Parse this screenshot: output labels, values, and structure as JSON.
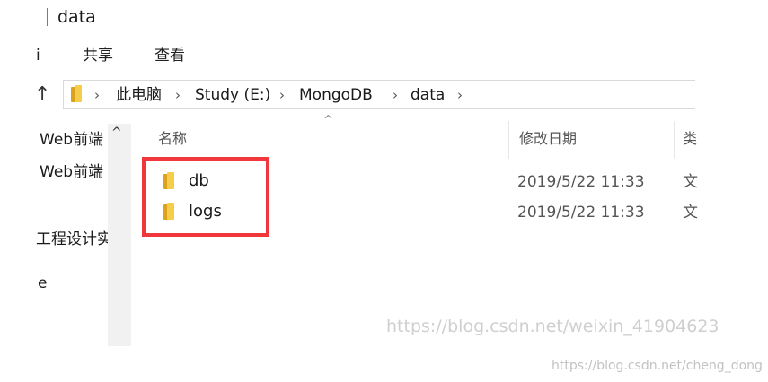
{
  "window": {
    "title": "data"
  },
  "ribbon": {
    "cut_fragment": "i",
    "tabs": [
      "共享",
      "查看"
    ]
  },
  "address": {
    "crumbs": [
      "此电脑",
      "Study (E:)",
      "MongoDB",
      "data"
    ]
  },
  "nav_pane": {
    "items": [
      "Web前端",
      "Web前端",
      "工程设计实",
      "e"
    ]
  },
  "columns": {
    "name": "名称",
    "date_modified": "修改日期",
    "type": "类"
  },
  "files": [
    {
      "name": "db",
      "date": "2019/5/22 11:33",
      "type": "文"
    },
    {
      "name": "logs",
      "date": "2019/5/22 11:33",
      "type": "文"
    }
  ],
  "watermarks": [
    "https://blog.csdn.net/weixin_41904623",
    "https://blog.csdn.net/cheng_dong"
  ],
  "colors": {
    "highlight": "#f0373b",
    "folder_light": "#f5cd4b",
    "folder_dark": "#dca21d"
  }
}
